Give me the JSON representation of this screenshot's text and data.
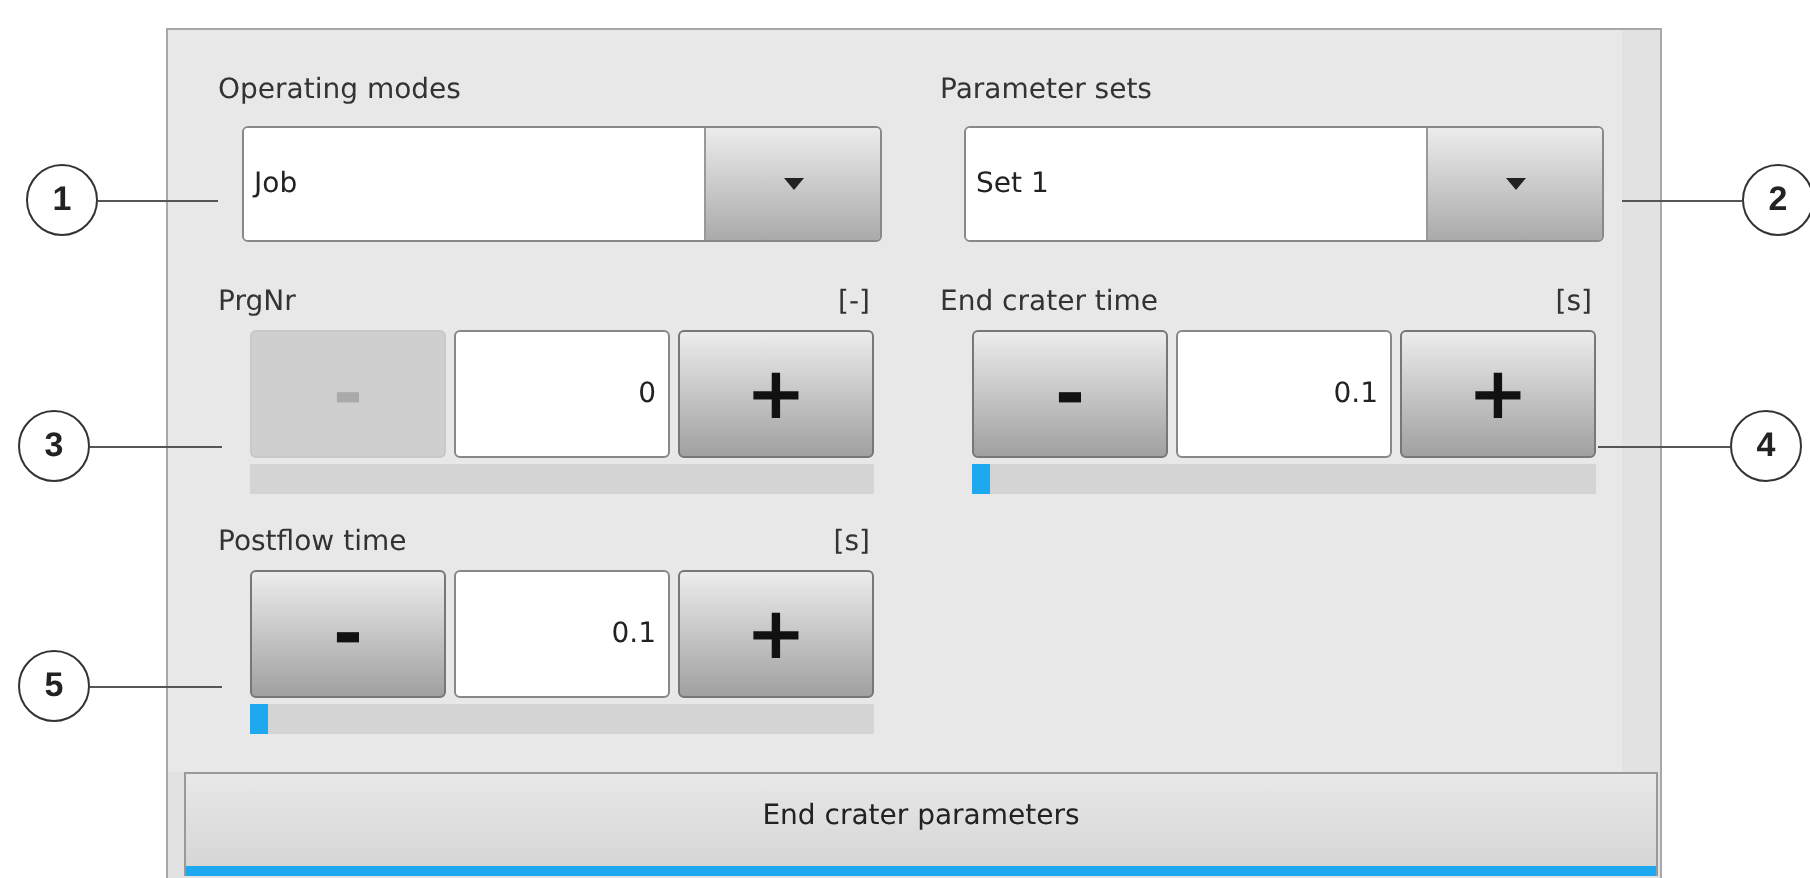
{
  "dropdowns": [
    {
      "label": "Operating modes",
      "value": "Job",
      "callout": "1"
    },
    {
      "label": "Parameter sets",
      "value": "Set 1",
      "callout": "2"
    }
  ],
  "steppers": [
    {
      "label": "PrgNr",
      "unit": "[-]",
      "value": "0",
      "minus": "-",
      "plus": "+",
      "minus_disabled": true,
      "callout": "3"
    },
    {
      "label": "End crater time",
      "unit": "[s]",
      "value": "0.1",
      "minus": "-",
      "plus": "+",
      "minus_disabled": false,
      "level": 0.03,
      "callout": "4"
    },
    {
      "label": "Postflow time",
      "unit": "[s]",
      "value": "0.1",
      "minus": "-",
      "plus": "+",
      "minus_disabled": false,
      "level": 0.03,
      "callout": "5"
    }
  ],
  "tab": {
    "label": "End crater parameters",
    "selected": true
  }
}
